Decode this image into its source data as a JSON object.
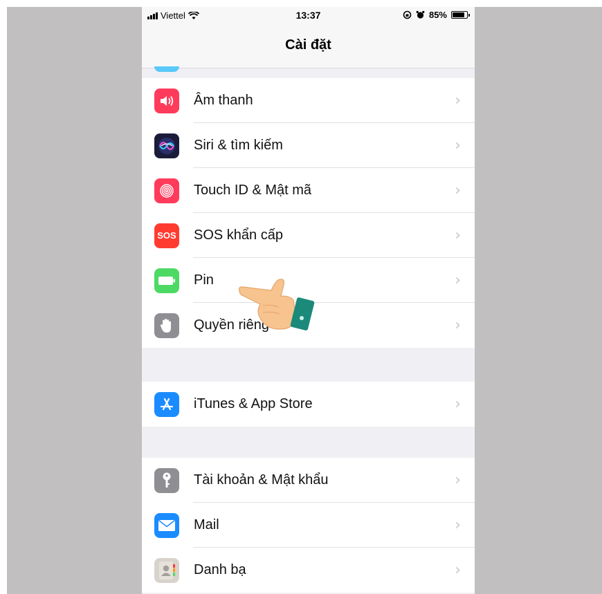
{
  "status_bar": {
    "carrier": "Viettel",
    "time": "13:37",
    "battery_text": "85%",
    "battery_level": 0.85,
    "icons": [
      "signal-bars",
      "wifi-icon",
      "orientation-lock-icon",
      "alarm-icon",
      "battery-icon"
    ]
  },
  "nav": {
    "title": "Cài đặt"
  },
  "groups": [
    {
      "items": [
        {
          "label": "Âm thanh",
          "icon": "sound-icon",
          "color": "#ff3b5c"
        },
        {
          "label": "Siri & tìm kiếm",
          "icon": "siri-icon",
          "color": "#1b1b3a"
        },
        {
          "label": "Touch ID & Mật mã",
          "icon": "fingerprint-icon",
          "color": "#ff3b5c"
        },
        {
          "label": "SOS khẩn cấp",
          "icon": "sos-icon",
          "color": "#ff3b30",
          "icon_text": "SOS"
        },
        {
          "label": "Pin",
          "icon": "battery-icon",
          "color": "#4cd964"
        },
        {
          "label": "Quyền riêng tư",
          "icon": "hand-icon",
          "color": "#8e8e93"
        }
      ]
    },
    {
      "items": [
        {
          "label": "iTunes & App Store",
          "icon": "app-store-icon",
          "color": "#1a8cff"
        }
      ]
    },
    {
      "items": [
        {
          "label": "Tài khoản & Mật khẩu",
          "icon": "key-icon",
          "color": "#8e8e93"
        },
        {
          "label": "Mail",
          "icon": "mail-icon",
          "color": "#1a8cff"
        },
        {
          "label": "Danh bạ",
          "icon": "contacts-icon",
          "color": "#d8d3cc"
        }
      ]
    }
  ],
  "chevron": "›",
  "overlay": {
    "icon": "pointing-hand-icon"
  }
}
